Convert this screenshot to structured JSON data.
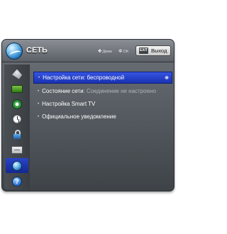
{
  "header": {
    "title": "СЕТЬ",
    "hint_move_glyph": "✥",
    "hint_move": "Движ",
    "hint_ok_glyph": "✲",
    "hint_ok": "OK",
    "exit_key": "EXIT",
    "exit_label": "Выход"
  },
  "sidebar": {
    "items": [
      {
        "name": "input-icon",
        "selected": false
      },
      {
        "name": "picture-icon",
        "selected": false
      },
      {
        "name": "audio-icon",
        "selected": false
      },
      {
        "name": "time-icon",
        "selected": false
      },
      {
        "name": "lock-icon",
        "selected": false
      },
      {
        "name": "option-icon",
        "selected": false
      },
      {
        "name": "network-icon",
        "selected": true
      },
      {
        "name": "support-icon",
        "selected": false,
        "glyph": "?"
      }
    ]
  },
  "menu": {
    "items": [
      {
        "label": "Настройка сети: беспроводной",
        "selected": true,
        "icon": "wifi-icon"
      },
      {
        "label": "Состояние сети",
        "status": " : Соединение не настроено"
      },
      {
        "label": "Настройка Smart TV"
      },
      {
        "label": "Официальное уведомление"
      }
    ],
    "bullet": "•",
    "wifi_glyph": "❋"
  },
  "colors": {
    "selection": "#2a45d4",
    "panel": "#4a4f54"
  }
}
